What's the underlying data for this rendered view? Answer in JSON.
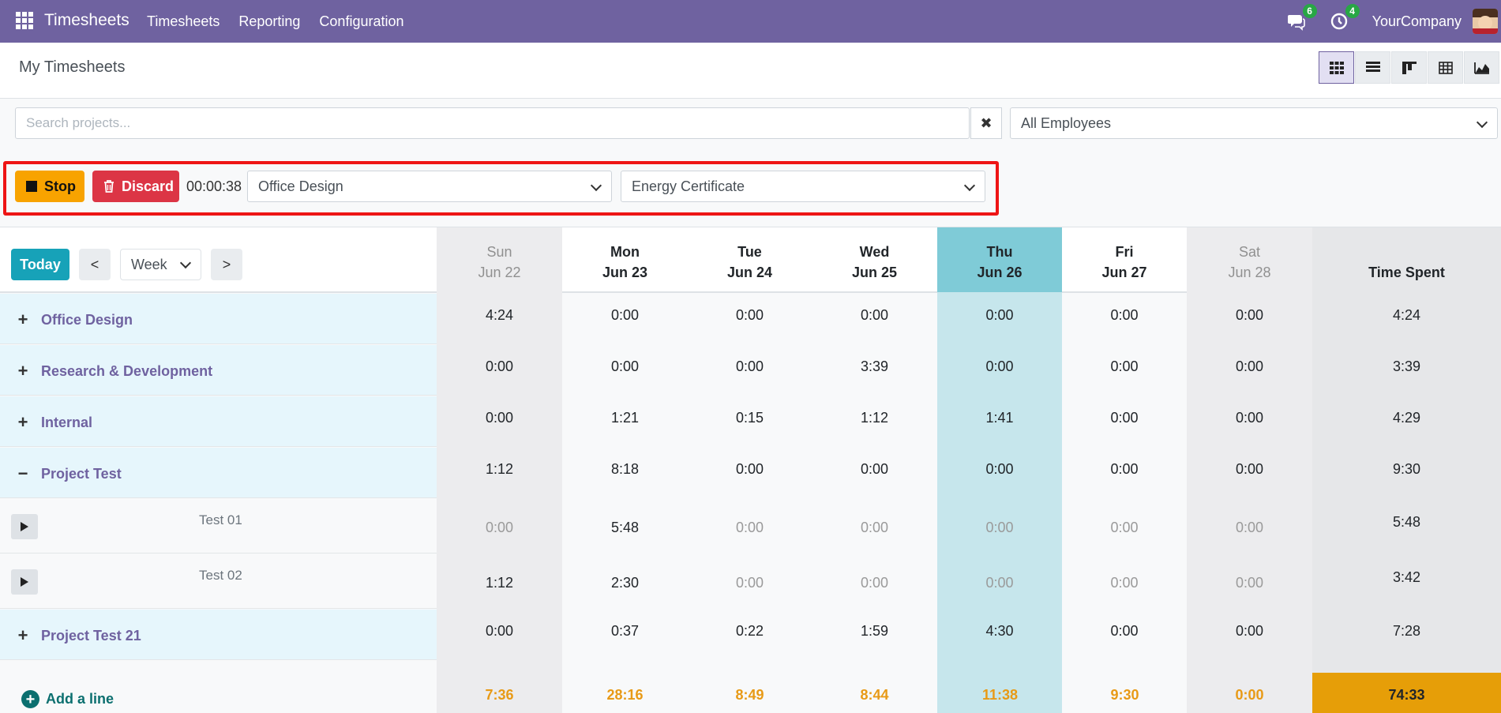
{
  "app": {
    "brand": "Timesheets",
    "menu": [
      "Timesheets",
      "Reporting",
      "Configuration"
    ],
    "messages_count": "6",
    "activities_count": "4",
    "company": "YourCompany"
  },
  "page": {
    "title": "My Timesheets"
  },
  "views": [
    "grid",
    "list",
    "kanban",
    "pivot",
    "graph"
  ],
  "search": {
    "placeholder": "Search projects...",
    "employee_filter": "All Employees"
  },
  "timer": {
    "stop_label": "Stop",
    "discard_label": "Discard",
    "elapsed": "00:00:38",
    "project": "Office Design",
    "task": "Energy Certificate"
  },
  "grid": {
    "today_label": "Today",
    "prev_label": "<",
    "next_label": ">",
    "range_label": "Week",
    "days": [
      {
        "name": "Sun",
        "date": "Jun 22",
        "weekend": true
      },
      {
        "name": "Mon",
        "date": "Jun 23",
        "weekend": false
      },
      {
        "name": "Tue",
        "date": "Jun 24",
        "weekend": false
      },
      {
        "name": "Wed",
        "date": "Jun 25",
        "weekend": false
      },
      {
        "name": "Thu",
        "date": "Jun 26",
        "weekend": false,
        "today": true
      },
      {
        "name": "Fri",
        "date": "Jun 27",
        "weekend": false
      },
      {
        "name": "Sat",
        "date": "Jun 28",
        "weekend": true
      }
    ],
    "total_header": "Time Spent",
    "rows": [
      {
        "kind": "group",
        "sign": "+",
        "label": "Office Design",
        "values": [
          "4:24",
          "0:00",
          "0:00",
          "0:00",
          "0:00",
          "0:00",
          "0:00"
        ],
        "total": "4:24"
      },
      {
        "kind": "group",
        "sign": "+",
        "label": "Research & Development",
        "values": [
          "0:00",
          "0:00",
          "0:00",
          "3:39",
          "0:00",
          "0:00",
          "0:00"
        ],
        "total": "3:39"
      },
      {
        "kind": "group",
        "sign": "+",
        "label": "Internal",
        "values": [
          "0:00",
          "1:21",
          "0:15",
          "1:12",
          "1:41",
          "0:00",
          "0:00"
        ],
        "total": "4:29"
      },
      {
        "kind": "group",
        "sign": "−",
        "label": "Project Test",
        "values": [
          "1:12",
          "8:18",
          "0:00",
          "0:00",
          "0:00",
          "0:00",
          "0:00"
        ],
        "total": "9:30"
      },
      {
        "kind": "task",
        "label": "Test 01",
        "values": [
          "0:00",
          "5:48",
          "0:00",
          "0:00",
          "0:00",
          "0:00",
          "0:00"
        ],
        "total": "5:48"
      },
      {
        "kind": "task",
        "label": "Test 02",
        "values": [
          "1:12",
          "2:30",
          "0:00",
          "0:00",
          "0:00",
          "0:00",
          "0:00"
        ],
        "total": "3:42"
      },
      {
        "kind": "group",
        "sign": "+",
        "label": "Project Test 21",
        "values": [
          "0:00",
          "0:37",
          "0:22",
          "1:59",
          "4:30",
          "0:00",
          "0:00"
        ],
        "total": "7:28"
      }
    ],
    "add_line_label": "Add a line",
    "totals": [
      "7:36",
      "28:16",
      "8:49",
      "8:44",
      "11:38",
      "9:30",
      "0:00"
    ],
    "grand_total": "74:33"
  },
  "colors": {
    "navbar": "#6f62a0",
    "stop": "#f8a300",
    "discard": "#dc3545",
    "today_btn": "#17a2b8",
    "today_col": "#7fcbd7",
    "highlight_border": "#ee1515",
    "total_text": "#e89a16",
    "grand_total_bg": "#e69e08"
  }
}
